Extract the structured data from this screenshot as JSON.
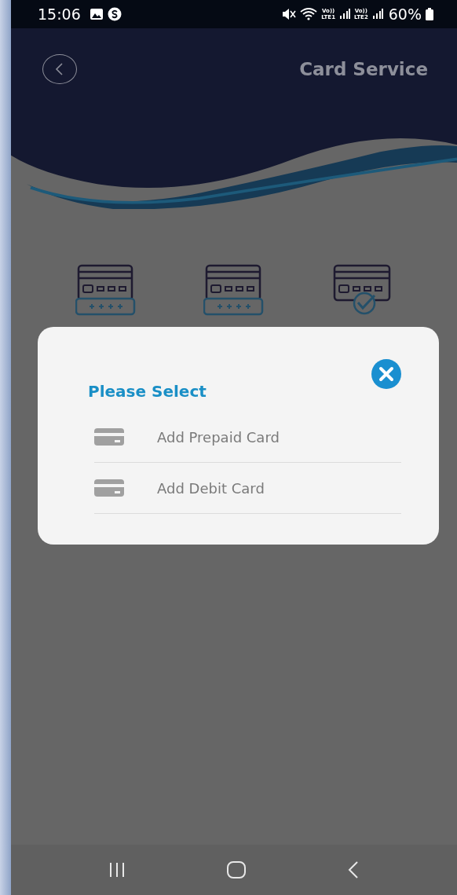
{
  "status_bar": {
    "time": "15:06",
    "lines": [
      {
        "top": "Vo))",
        "bottom": "LTE1"
      },
      {
        "top": "Vo))",
        "bottom": "LTE2"
      }
    ],
    "battery": "60%"
  },
  "header": {
    "title": "Card Service"
  },
  "menu_icons": [
    {
      "kind": "pin"
    },
    {
      "kind": "pin"
    },
    {
      "kind": "check"
    }
  ],
  "dialog": {
    "title": "Please Select",
    "options": [
      {
        "label": "Add Prepaid Card"
      },
      {
        "label": "Add Debit Card"
      }
    ]
  }
}
